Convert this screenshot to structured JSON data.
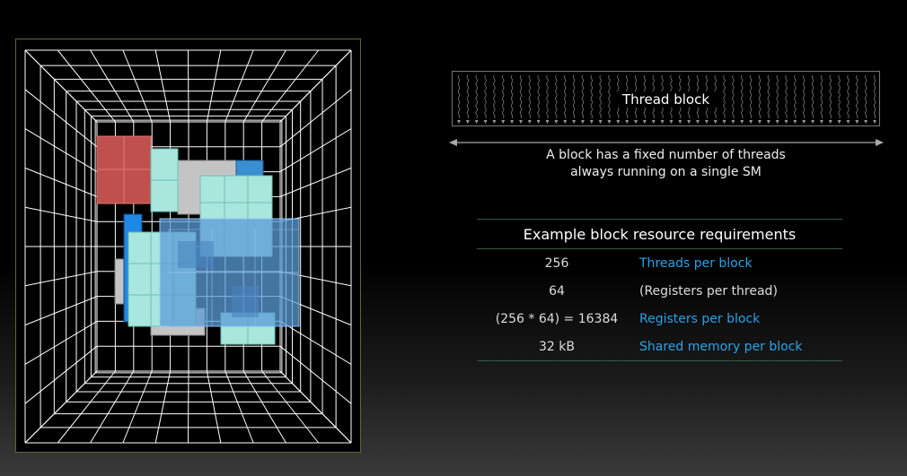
{
  "thread_block": {
    "label": "Thread block"
  },
  "caption": {
    "line1": "A block has a fixed number of threads",
    "line2": "always running on a single SM"
  },
  "table": {
    "title": "Example block resource requirements",
    "rows": [
      {
        "value": "256",
        "description": "Threads per block",
        "highlight": true
      },
      {
        "value": "64",
        "description": "(Registers per thread)",
        "highlight": false
      },
      {
        "value": "(256 * 64) = 16384",
        "description": "Registers per block",
        "highlight": true
      },
      {
        "value": "32 kB",
        "description": "Shared memory per block",
        "highlight": true
      }
    ]
  },
  "colors": {
    "highlight_text": "#29a3e8",
    "grid_lines": "#ffffff",
    "block_red": "#c0504d",
    "block_cyan": "#a8e6de",
    "block_gray": "#bfbfbf",
    "block_blue": "#5b9bd5",
    "block_blue_strong": "#1e88e5"
  }
}
